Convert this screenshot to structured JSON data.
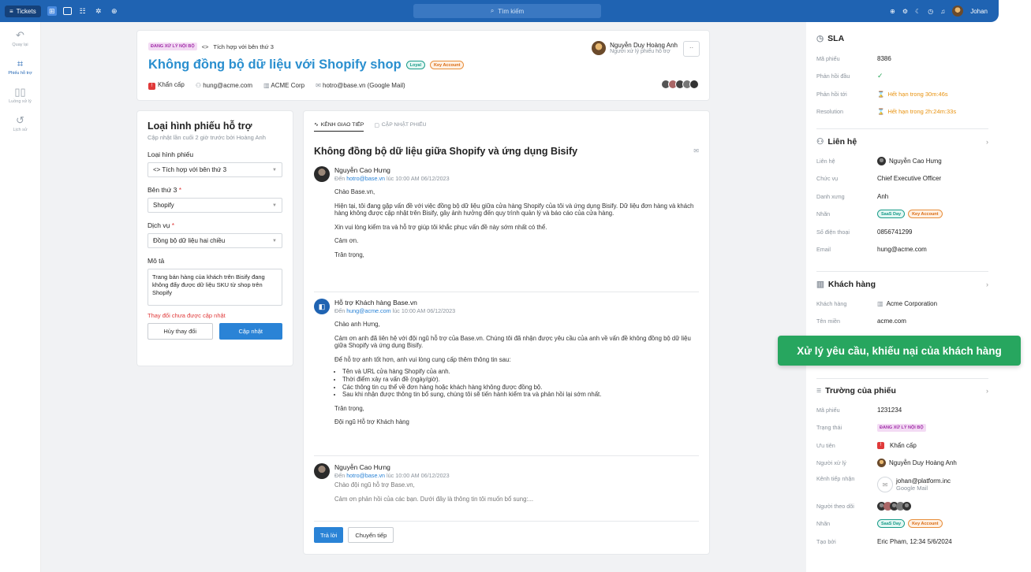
{
  "topbar": {
    "tickets_label": "Tickets",
    "search_placeholder": "Tìm kiếm",
    "user_name": "Johan"
  },
  "sidebar": {
    "items": [
      {
        "label": "Quay lại",
        "icon": "undo-icon"
      },
      {
        "label": "Phiếu hỗ trợ",
        "icon": "ticket-icon"
      },
      {
        "label": "Luồng xử lý",
        "icon": "columns-icon"
      },
      {
        "label": "Lịch sử",
        "icon": "history-icon"
      }
    ]
  },
  "ticket": {
    "status_badge": "ĐANG XỬ LÝ NỘI BỘ",
    "category": "Tích hợp với bên thứ 3",
    "title": "Không đồng bộ dữ liệu với Shopify shop",
    "tags": [
      "Loyal",
      "Key Account"
    ],
    "priority": "Khẩn cấp",
    "email": "hung@acme.com",
    "company": "ACME Corp",
    "channel": "hotro@base.vn (Google Mail)",
    "assignee_name": "Nguyễn Duy Hoàng Anh",
    "assignee_role": "Người xử lý phiếu hỗ trợ",
    "more": "··"
  },
  "form": {
    "title": "Loại hình phiếu hỗ trợ",
    "subtitle": "Cập nhật lần cuối 2 giờ trước bởi Hoàng Anh",
    "type_label": "Loại hình phiếu",
    "type_value": "Tích hợp với bên thứ 3",
    "third_party_label": "Bên thứ 3",
    "third_party_value": "Shopify",
    "service_label": "Dịch vụ",
    "service_value": "Đồng bộ dữ liệu hai chiều",
    "description_label": "Mô tả",
    "description_value": "Trang bán hàng của khách trên Bisify đang không đẩy được dữ liệu SKU từ shop trên Shopify",
    "unsaved_warning": "Thay đổi chưa được cập nhật",
    "cancel_label": "Hủy thay đổi",
    "save_label": "Cập nhật",
    "required_mark": "*"
  },
  "conversation": {
    "tabs": [
      "KÊNH GIAO TIẾP",
      "CẬP NHẬT PHIẾU"
    ],
    "title": "Không đồng bộ dữ liệu giữa Shopify và ứng dụng Bisify",
    "to_prefix": "Đến",
    "at_text": "lúc",
    "messages": [
      {
        "sender": "Nguyễn Cao Hưng",
        "to": "hotro@base.vn",
        "time": "10:00 AM 06/12/2023",
        "paragraphs": [
          "Chào Base.vn,",
          "Hiện tại, tôi đang gặp vấn đề với việc đồng bộ dữ liệu giữa cửa hàng Shopify của tôi và ứng dụng Bisify. Dữ liệu đơn hàng và khách hàng không được cập nhật trên Bisify, gây ảnh hưởng đến quy trình quản lý và báo cáo của cửa hàng.",
          "Xin vui lòng kiểm tra và hỗ trợ giúp tôi khắc phục vấn đề này sớm nhất có thể.",
          "Cảm ơn.",
          "Trân trọng,"
        ]
      },
      {
        "sender": "Hỗ trợ Khách hàng Base.vn",
        "to": "hung@acme.com",
        "time": "10:00 AM 06/12/2023",
        "p1": "Chào anh Hưng,",
        "p2": "Cảm ơn anh đã liên hệ với đội ngũ hỗ trợ của Base.vn. Chúng tôi đã nhận được yêu cầu của anh về vấn đề không đồng bộ dữ liệu giữa Shopify và ứng dụng Bisify.",
        "p3": "Để hỗ trợ anh tốt hơn, anh vui lòng cung cấp thêm thông tin sau:",
        "bullets": [
          "Tên và URL cửa hàng Shopify của anh.",
          "Thời điểm xảy ra vấn đề (ngày/giờ).",
          "Các thông tin cụ thể về đơn hàng hoặc khách hàng không được đồng bộ.",
          "Sau khi nhận được thông tin bổ sung, chúng tôi sẽ tiến hành kiểm tra và phản hồi lại sớm nhất."
        ],
        "p4": "Trân trọng,",
        "p5": "Đội ngũ Hỗ trợ Khách hàng"
      },
      {
        "sender": "Nguyễn Cao Hưng",
        "to": "hotro@base.vn",
        "time": "10:00 AM 06/12/2023",
        "p1": "Chào đội ngũ hỗ trợ Base.vn,",
        "p2": "Cảm ơn phản hồi của các bạn. Dưới đây là thông tin tôi muốn bổ sung:..."
      }
    ],
    "reply_label": "Trả lời",
    "forward_label": "Chuyển tiếp"
  },
  "sla": {
    "title": "SLA",
    "rows": [
      {
        "k": "Mã phiếu",
        "v": "8386"
      },
      {
        "k": "Phản hồi đầu",
        "v": "✓"
      },
      {
        "k": "Phản hồi tới",
        "v": "Hết hạn trong 30m:46s"
      },
      {
        "k": "Resolution",
        "v": "Hết hạn trong 2h:24m:33s"
      }
    ]
  },
  "contact": {
    "title": "Liên hệ",
    "rows": [
      {
        "k": "Liên hệ",
        "v": "Nguyễn Cao Hưng"
      },
      {
        "k": "Chức vụ",
        "v": "Chief Executive Officer"
      },
      {
        "k": "Danh xưng",
        "v": "Anh"
      },
      {
        "k": "Nhãn",
        "v": ""
      },
      {
        "k": "Số điện thoại",
        "v": "0856741299"
      },
      {
        "k": "Email",
        "v": "hung@acme.com"
      }
    ],
    "tags": [
      "SaaS Day",
      "Key Account"
    ]
  },
  "customer": {
    "title": "Khách hàng",
    "rows": [
      {
        "k": "Khách hàng",
        "v": "Acme Corporation"
      },
      {
        "k": "Tên miền",
        "v": "acme.com"
      }
    ]
  },
  "fields": {
    "title": "Trường của phiếu",
    "rows": [
      {
        "k": "Mã phiếu",
        "v": "1231234"
      },
      {
        "k": "Trạng thái",
        "v": "ĐANG XỬ LÝ NỘI BỘ"
      },
      {
        "k": "Ưu tiên",
        "v": "Khẩn cấp"
      },
      {
        "k": "Người xử lý",
        "v": "Nguyễn Duy Hoàng Anh"
      },
      {
        "k": "Kênh tiếp nhận",
        "v": "johan@platform.inc",
        "v2": "Google Mail"
      },
      {
        "k": "Người theo dõi",
        "v": ""
      },
      {
        "k": "Nhãn",
        "v": ""
      },
      {
        "k": "Tạo bởi",
        "v": "Eric Pham, 12:34 5/6/2024"
      }
    ]
  },
  "toast": {
    "message": "Xử lý yêu cầu, khiếu nại của khách hàng"
  },
  "colors": {
    "accent": "#1f63b2",
    "title_blue": "#2a8fcf",
    "toast_green": "#27a65f",
    "warning_red": "#e03a3a",
    "sla_orange": "#e8920f"
  }
}
